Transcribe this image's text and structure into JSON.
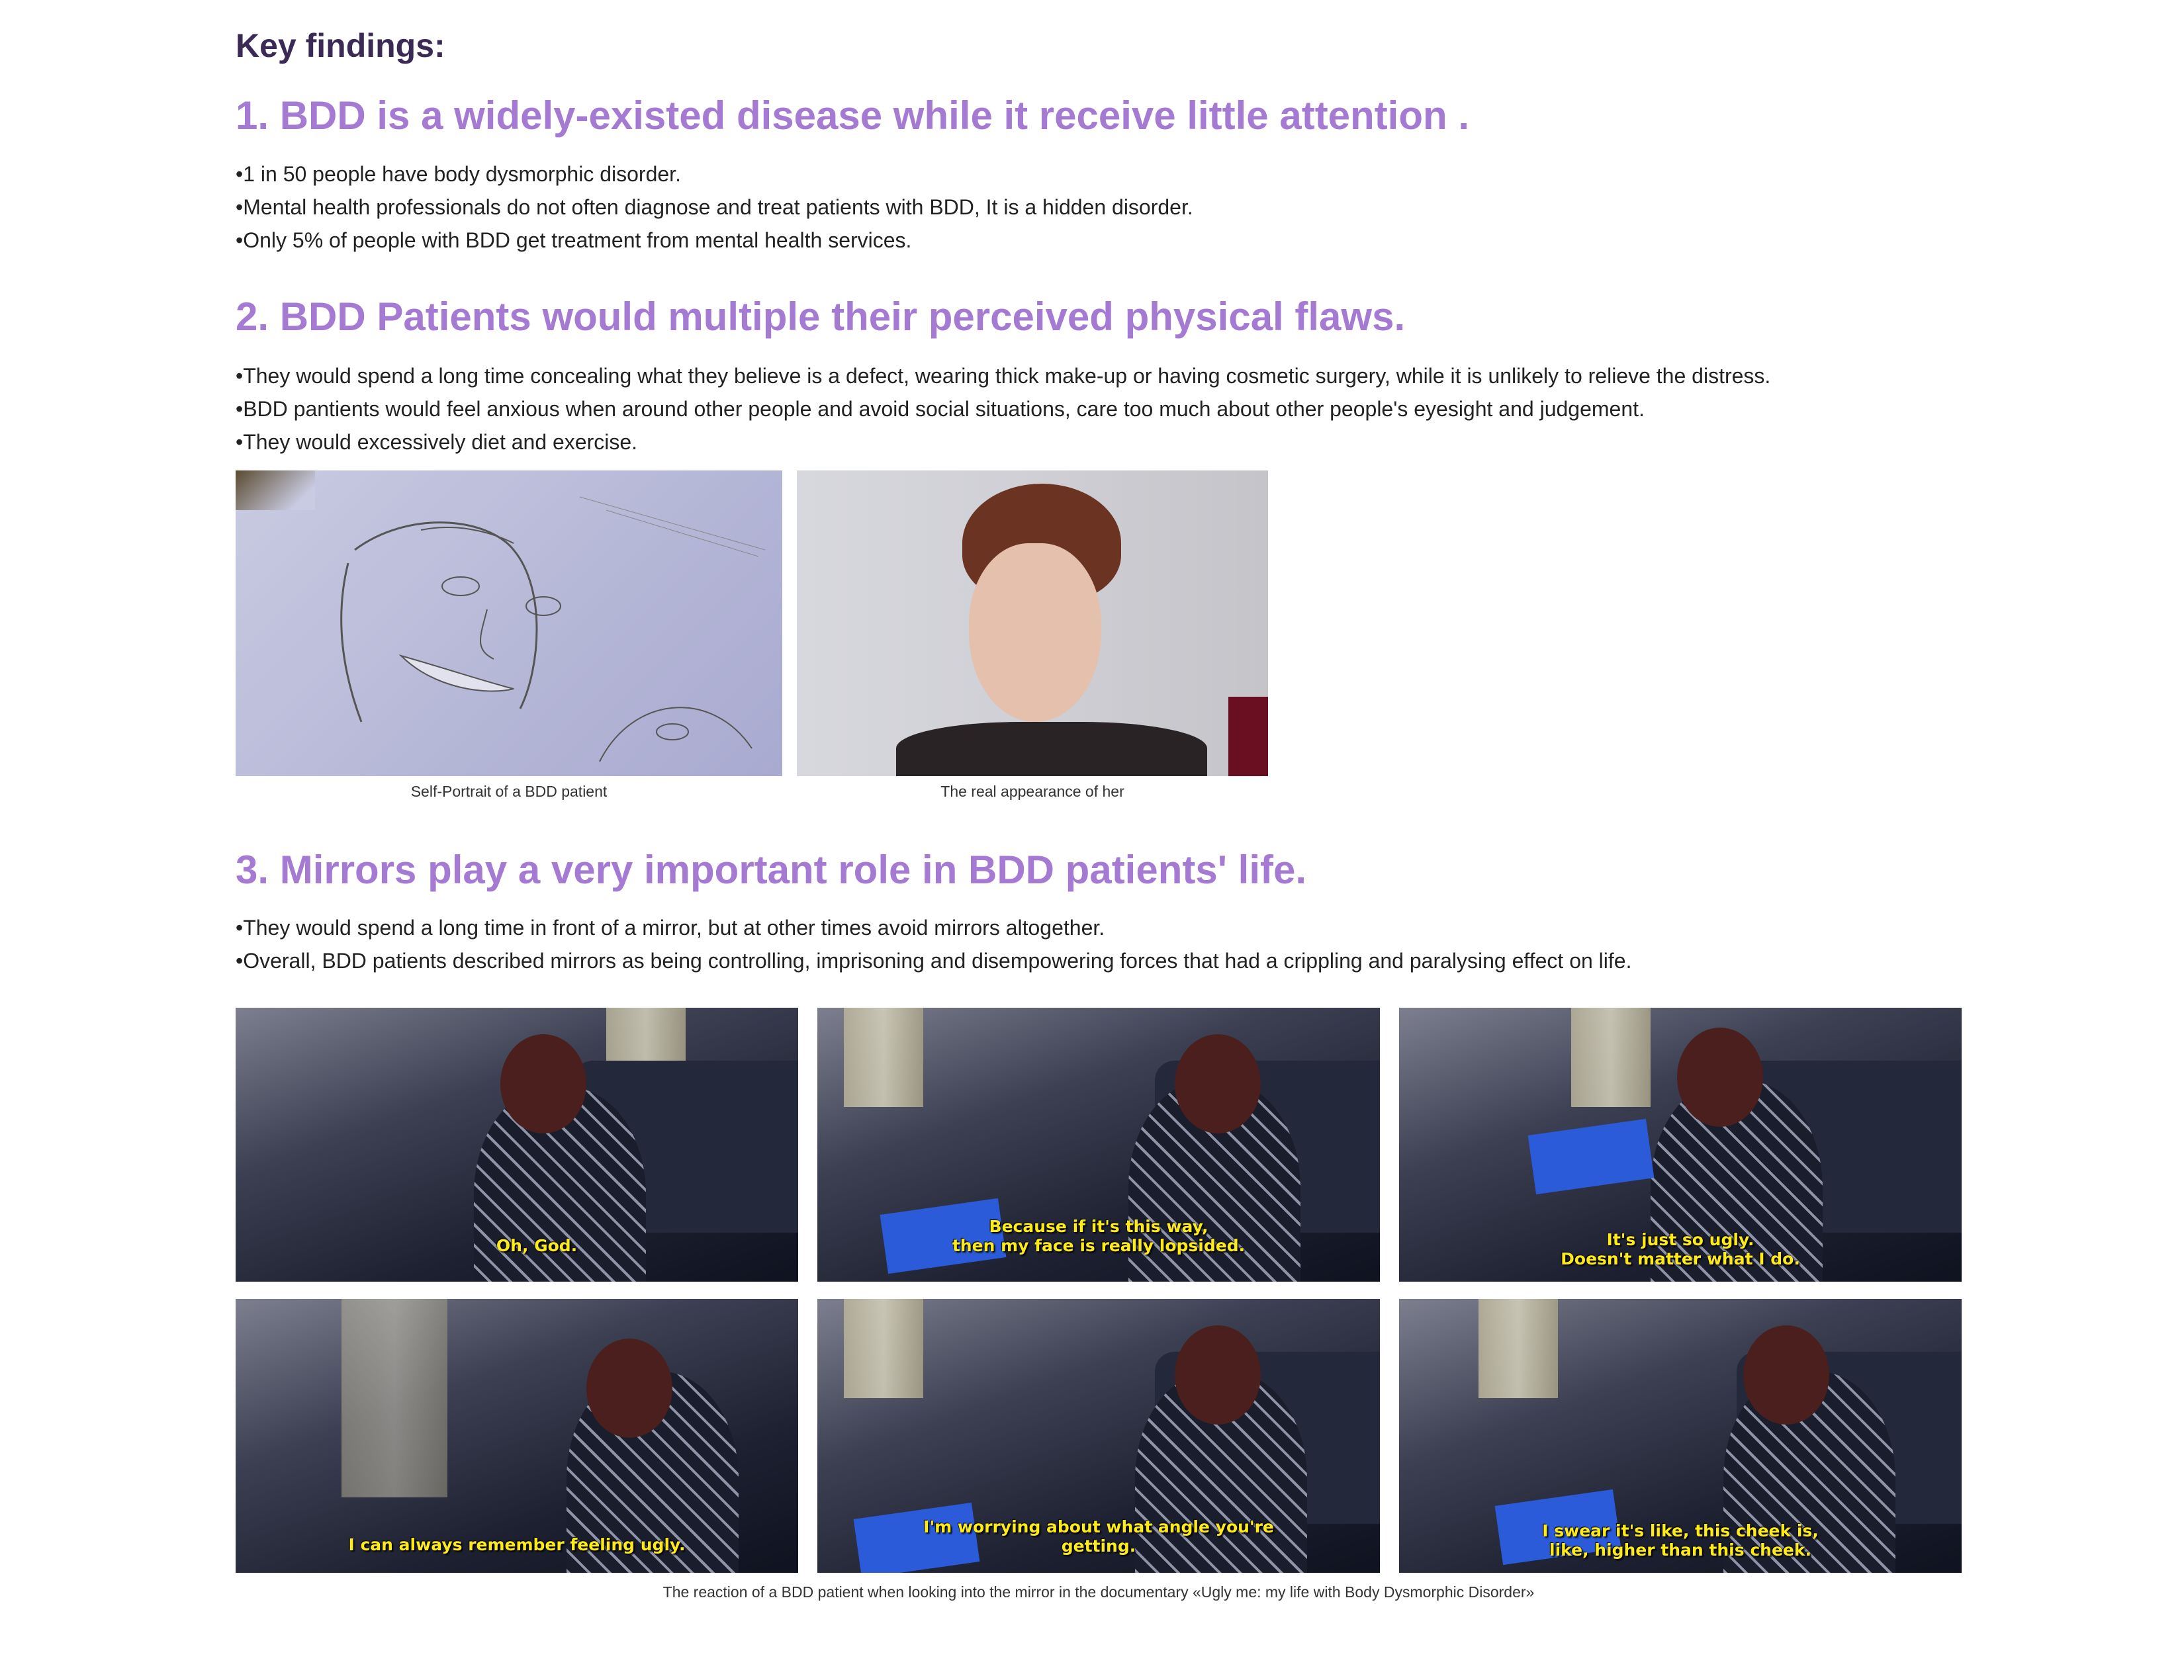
{
  "key_findings": "Key findings:",
  "sections": [
    {
      "title": "1. BDD is a widely-existed disease while it receive little attention .",
      "bullets": [
        "1 in 50 people have body dysmorphic disorder.",
        "Mental health professionals do not often diagnose and treat patients with BDD,  It is a hidden disorder.",
        "Only 5% of people with BDD get treatment from mental health services."
      ]
    },
    {
      "title": "2. BDD Patients would multiple their perceived physical flaws.",
      "bullets": [
        "They would spend a long time concealing what they believe is a defect, wearing thick make-up or having cosmetic surgery, while it is unlikely to relieve the distress.",
        "BDD pantients would feel anxious when around other people and avoid social situations, care too much  about other people's eyesight and judgement.",
        "They would excessively diet and exercise."
      ],
      "figures": [
        {
          "caption": "Self-Portrait of a BDD patient"
        },
        {
          "caption": "The real appearance of her"
        }
      ]
    },
    {
      "title": "3. Mirrors play a very important role in BDD patients' life.",
      "bullets": [
        "They would spend a long time in front of a mirror, but at other times avoid mirrors altogether.",
        "Overall, BDD patients described mirrors as being controlling, imprisoning and disempowering forces that had a crippling and paralysing effect on life."
      ],
      "stills": [
        {
          "subtitle": "Oh, God."
        },
        {
          "subtitle": "Because if it's this way,\nthen my face is really lopsided."
        },
        {
          "subtitle": "It's just so ugly.\nDoesn't matter what I do."
        },
        {
          "subtitle": "I can always remember feeling ugly."
        },
        {
          "subtitle": "I'm worrying about what angle you're\ngetting."
        },
        {
          "subtitle": "I swear it's like, this cheek is,\nlike, higher than this cheek."
        }
      ],
      "stills_caption": "The reaction of a BDD patient when looking into the mirror in the documentary   «Ugly me: my life with  Body Dysmorphic Disorder»"
    }
  ]
}
